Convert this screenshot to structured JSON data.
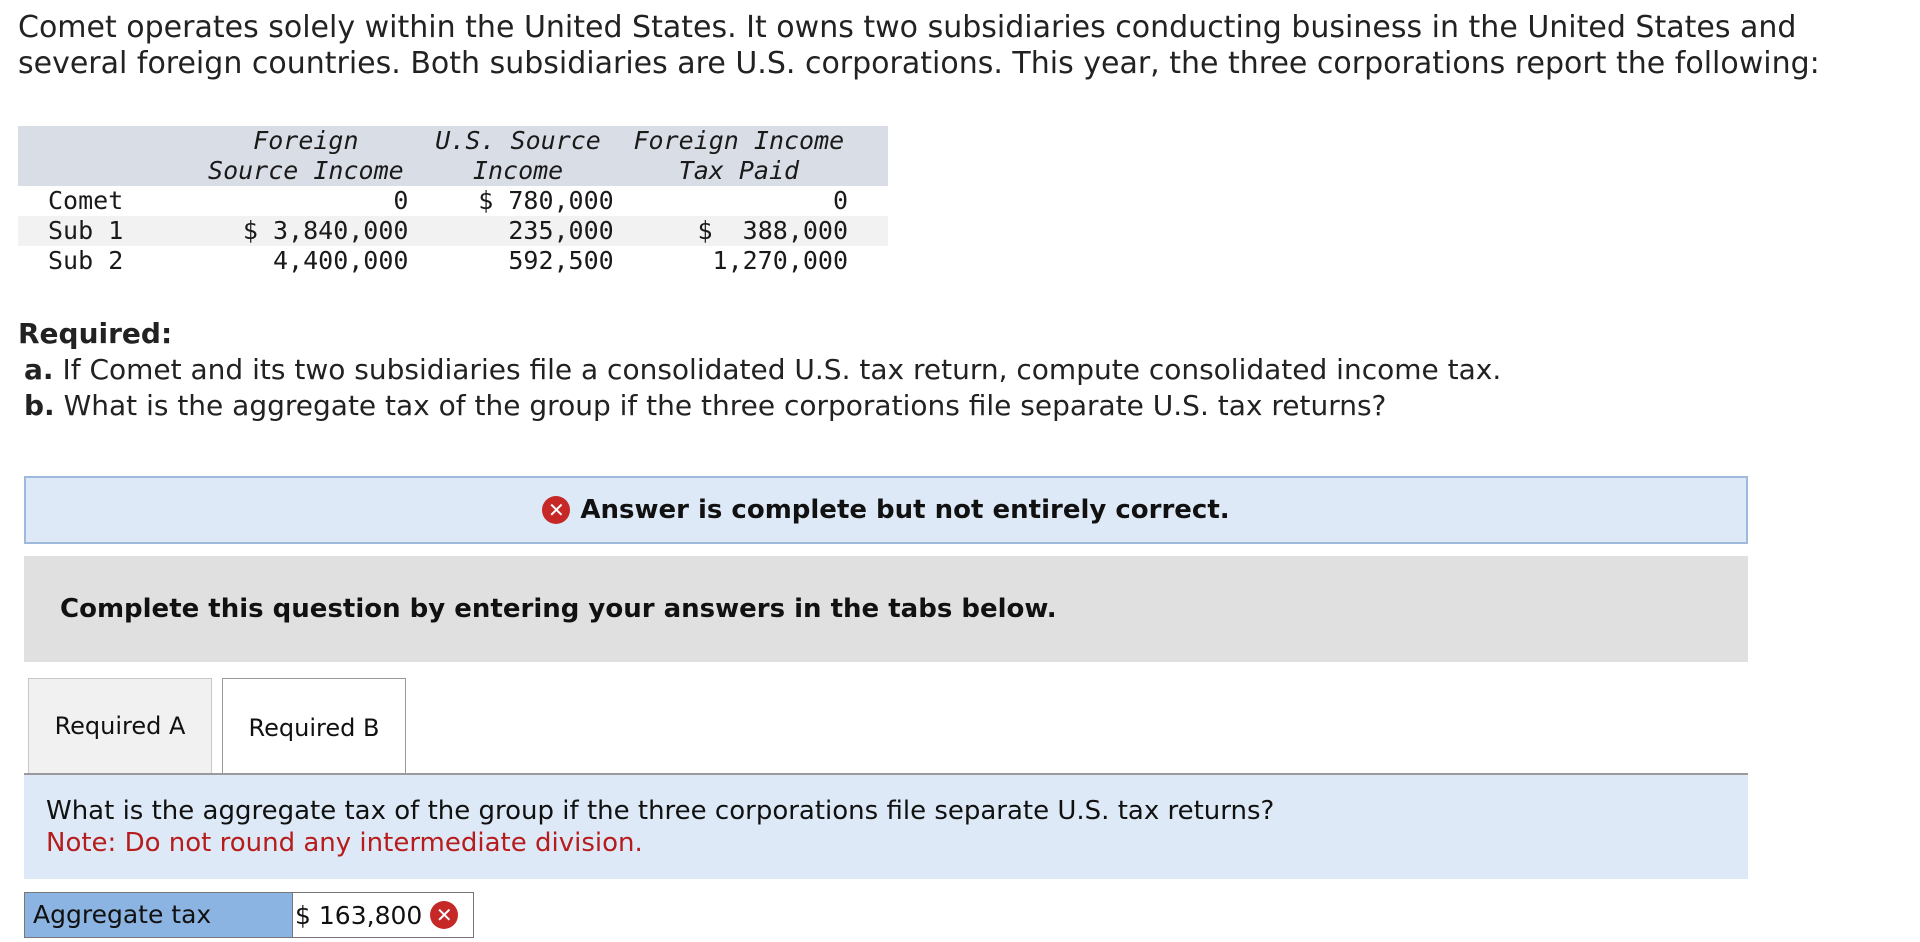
{
  "intro": {
    "text": "Comet operates solely within the United States. It owns two subsidiaries conducting business in the United States and several foreign countries. Both subsidiaries are U.S. corporations. This year, the three corporations report the following:"
  },
  "table": {
    "headers": {
      "col1": "Foreign Source Income",
      "col2": "U.S. Source Income",
      "col3": "Foreign Income Tax Paid"
    },
    "rows": [
      {
        "name": "Comet",
        "foreign": "0",
        "us": "$ 780,000",
        "tax": "0"
      },
      {
        "name": "Sub 1",
        "foreign": "$ 3,840,000",
        "us": "235,000",
        "tax": "$  388,000"
      },
      {
        "name": "Sub 2",
        "foreign": "4,400,000",
        "us": "592,500",
        "tax": "1,270,000"
      }
    ]
  },
  "required": {
    "title": "Required:",
    "a_label": "a.",
    "a_text": "If Comet and its two subsidiaries file a consolidated U.S. tax return, compute consolidated income tax.",
    "b_label": "b.",
    "b_text": "What is the aggregate tax of the group if the three corporations file separate U.S. tax returns?"
  },
  "banner": {
    "icon": "x-circle-icon",
    "text": "Answer is complete but not entirely correct.",
    "icon_color": "#c62828"
  },
  "instructions": {
    "text": "Complete this question by entering your answers in the tabs below."
  },
  "tabs": {
    "a": "Required A",
    "b": "Required B",
    "active": "Required B"
  },
  "question": {
    "text": "What is the aggregate tax of the group if the three corporations file separate U.S. tax returns?",
    "note": "Note: Do not round any intermediate division."
  },
  "answer": {
    "label": "Aggregate tax",
    "currency": "$",
    "value": "163,800",
    "status_icon": "x-circle-icon"
  }
}
